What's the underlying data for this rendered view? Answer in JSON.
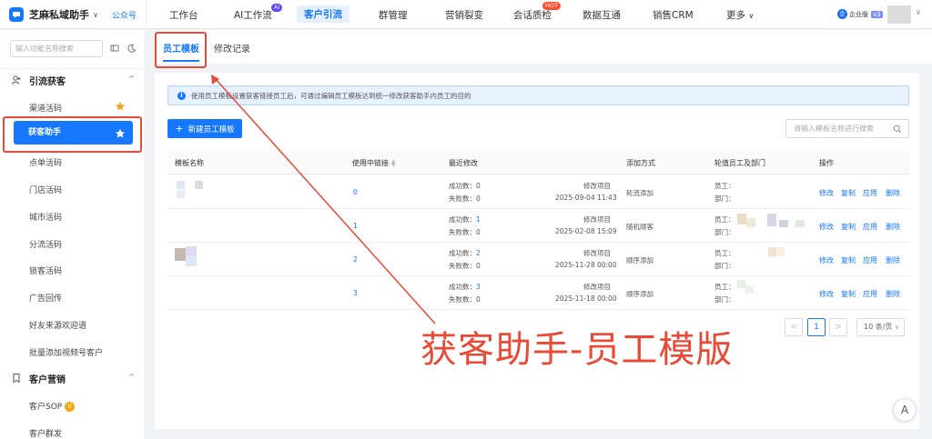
{
  "brand": {
    "name": "芝麻私域助手",
    "caret": "∨",
    "account_type": "公众号"
  },
  "topnav": [
    {
      "label": "工作台"
    },
    {
      "label": "AI工作流",
      "badge": "AI"
    },
    {
      "label": "客户引流",
      "active": true
    },
    {
      "label": "群管理"
    },
    {
      "label": "营销裂变"
    },
    {
      "label": "会话质检",
      "badge": "HOT"
    },
    {
      "label": "数据互通"
    },
    {
      "label": "销售CRM"
    },
    {
      "label": "更多",
      "caret": "∨"
    }
  ],
  "enterprise": {
    "icon": "企",
    "label": "企业版",
    "version": "v3"
  },
  "sidebar": {
    "search_placeholder": "输入功能名称搜索",
    "section1": {
      "title": "引流获客",
      "caret": "^"
    },
    "items": [
      {
        "label": "渠道活码",
        "star": true
      },
      {
        "label": "获客助手",
        "active": true,
        "star": true
      },
      {
        "label": "点单活码"
      },
      {
        "label": "门店活码"
      },
      {
        "label": "城市活码"
      },
      {
        "label": "分流活码"
      },
      {
        "label": "锁客活码"
      },
      {
        "label": "广告回传"
      },
      {
        "label": "好友来源欢迎语"
      },
      {
        "label": "批量添加视频号客户"
      }
    ],
    "section2": {
      "title": "客户营销",
      "caret": "^"
    },
    "items2": [
      {
        "label": "客户SOP",
        "tag": "V"
      },
      {
        "label": "客户群发"
      }
    ]
  },
  "tabs": [
    {
      "label": "员工模板",
      "active": true
    },
    {
      "label": "修改记录"
    }
  ],
  "info_banner": "使用员工模板设置获客链接员工后，可通过编辑员工模板达到统一修改获客助手内员工的目的",
  "new_button": "新建员工模板",
  "template_search_placeholder": "请输入模板名称进行搜索",
  "table": {
    "columns": [
      "模板名称",
      "使用中链接",
      "最近修改",
      "添加方式",
      "轮值员工及部门",
      "操作"
    ],
    "rows": [
      {
        "links": "0",
        "success_label": "成功数：",
        "success": "0",
        "fail_label": "失败数：",
        "fail": "0",
        "modified_label": "修改项目",
        "modified_at": "2025-09-04 11:43",
        "add_method": "轮流添加",
        "staff_label": "员工：",
        "dept_label": "部门："
      },
      {
        "links": "1",
        "success_label": "成功数：",
        "success": "1",
        "fail_label": "失败数：",
        "fail": "0",
        "modified_label": "修改项目",
        "modified_at": "2025-02-08 15:09",
        "add_method": "随机顺客",
        "staff_label": "员工：",
        "dept_label": "部门："
      },
      {
        "links": "2",
        "success_label": "成功数：",
        "success": "2",
        "fail_label": "失败数：",
        "fail": "0",
        "modified_label": "修改项目",
        "modified_at": "2025-11-28 00:00",
        "add_method": "顺序添加",
        "staff_label": "员工：",
        "dept_label": "部门："
      },
      {
        "links": "3",
        "success_label": "成功数：",
        "success": "3",
        "fail_label": "失败数：",
        "fail": "0",
        "modified_label": "修改项目",
        "modified_at": "2025-11-18 00:00",
        "add_method": "顺序添加",
        "staff_label": "员工：",
        "dept_label": "部门："
      }
    ],
    "actions": [
      "修改",
      "复制",
      "应用",
      "删除"
    ]
  },
  "pagination": {
    "prev": "<",
    "current": "1",
    "next": ">",
    "page_size": "10 条/页"
  },
  "annotation": "获客助手-员工模版",
  "float_button": "A",
  "colors": {
    "accent": "#1677ff",
    "annotation_red": "#e84a35",
    "star": "#f5a623"
  }
}
